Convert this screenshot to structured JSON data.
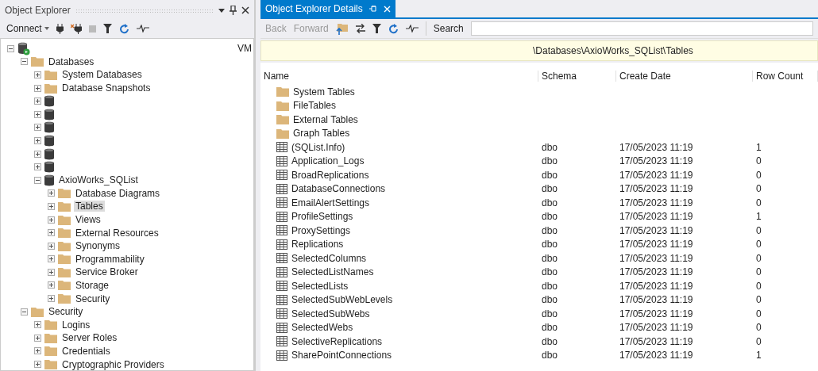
{
  "object_explorer": {
    "title": "Object Explorer",
    "toolbar": {
      "connect": "Connect"
    },
    "tree": [
      {
        "kind": "server",
        "label": "VM",
        "expanded": true,
        "selected": false,
        "children": [
          {
            "kind": "folder",
            "label": "Databases",
            "expanded": true,
            "selected": false,
            "children": [
              {
                "kind": "folder",
                "label": "System Databases",
                "expanded": false,
                "selected": false
              },
              {
                "kind": "folder",
                "label": "Database Snapshots",
                "expanded": false,
                "selected": false
              },
              {
                "kind": "database",
                "expanded": false,
                "selected": false
              },
              {
                "kind": "database",
                "expanded": false,
                "selected": false
              },
              {
                "kind": "database",
                "expanded": false,
                "selected": false
              },
              {
                "kind": "database",
                "expanded": false,
                "selected": false
              },
              {
                "kind": "database",
                "expanded": false,
                "selected": false
              },
              {
                "kind": "database",
                "expanded": false,
                "selected": false
              },
              {
                "kind": "database",
                "label": "AxioWorks_SQList",
                "expanded": true,
                "selected": false,
                "children": [
                  {
                    "kind": "folder",
                    "label": "Database Diagrams",
                    "expanded": false,
                    "selected": false
                  },
                  {
                    "kind": "folder",
                    "label": "Tables",
                    "expanded": false,
                    "selected": true
                  },
                  {
                    "kind": "folder",
                    "label": "Views",
                    "expanded": false,
                    "selected": false
                  },
                  {
                    "kind": "folder",
                    "label": "External Resources",
                    "expanded": false,
                    "selected": false
                  },
                  {
                    "kind": "folder",
                    "label": "Synonyms",
                    "expanded": false,
                    "selected": false
                  },
                  {
                    "kind": "folder",
                    "label": "Programmability",
                    "expanded": false,
                    "selected": false
                  },
                  {
                    "kind": "folder",
                    "label": "Service Broker",
                    "expanded": false,
                    "selected": false
                  },
                  {
                    "kind": "folder",
                    "label": "Storage",
                    "expanded": false,
                    "selected": false
                  },
                  {
                    "kind": "folder",
                    "label": "Security",
                    "expanded": false,
                    "selected": false
                  }
                ]
              }
            ]
          },
          {
            "kind": "folder",
            "label": "Security",
            "expanded": true,
            "selected": false,
            "children": [
              {
                "kind": "folder",
                "label": "Logins",
                "expanded": false,
                "selected": false
              },
              {
                "kind": "folder",
                "label": "Server Roles",
                "expanded": false,
                "selected": false
              },
              {
                "kind": "folder",
                "label": "Credentials",
                "expanded": false,
                "selected": false
              },
              {
                "kind": "folder",
                "label": "Cryptographic Providers",
                "expanded": false,
                "selected": false
              }
            ]
          }
        ]
      }
    ]
  },
  "details": {
    "tab": {
      "label": "Object Explorer Details",
      "selected": true
    },
    "toolbar": {
      "back": {
        "label": "Back",
        "disabled": true
      },
      "forward": {
        "label": "Forward",
        "disabled": true
      },
      "search_label": "Search"
    },
    "path": "\\Databases\\AxioWorks_SQList\\Tables",
    "table": {
      "columns": [
        "Name",
        "Schema",
        "Create Date",
        "Row Count"
      ],
      "rows": [
        {
          "kind": "folder",
          "name": "System Tables"
        },
        {
          "kind": "folder",
          "name": "FileTables"
        },
        {
          "kind": "folder",
          "name": "External Tables"
        },
        {
          "kind": "folder",
          "name": "Graph Tables"
        },
        {
          "kind": "table",
          "name": "(SQList.Info)",
          "schema": "dbo",
          "create_date": "17/05/2023 11:19",
          "row_count": "1"
        },
        {
          "kind": "table",
          "name": "Application_Logs",
          "schema": "dbo",
          "create_date": "17/05/2023 11:19",
          "row_count": "0"
        },
        {
          "kind": "table",
          "name": "BroadReplications",
          "schema": "dbo",
          "create_date": "17/05/2023 11:19",
          "row_count": "0"
        },
        {
          "kind": "table",
          "name": "DatabaseConnections",
          "schema": "dbo",
          "create_date": "17/05/2023 11:19",
          "row_count": "0"
        },
        {
          "kind": "table",
          "name": "EmailAlertSettings",
          "schema": "dbo",
          "create_date": "17/05/2023 11:19",
          "row_count": "0"
        },
        {
          "kind": "table",
          "name": "ProfileSettings",
          "schema": "dbo",
          "create_date": "17/05/2023 11:19",
          "row_count": "1"
        },
        {
          "kind": "table",
          "name": "ProxySettings",
          "schema": "dbo",
          "create_date": "17/05/2023 11:19",
          "row_count": "0"
        },
        {
          "kind": "table",
          "name": "Replications",
          "schema": "dbo",
          "create_date": "17/05/2023 11:19",
          "row_count": "0"
        },
        {
          "kind": "table",
          "name": "SelectedColumns",
          "schema": "dbo",
          "create_date": "17/05/2023 11:19",
          "row_count": "0"
        },
        {
          "kind": "table",
          "name": "SelectedListNames",
          "schema": "dbo",
          "create_date": "17/05/2023 11:19",
          "row_count": "0"
        },
        {
          "kind": "table",
          "name": "SelectedLists",
          "schema": "dbo",
          "create_date": "17/05/2023 11:19",
          "row_count": "0"
        },
        {
          "kind": "table",
          "name": "SelectedSubWebLevels",
          "schema": "dbo",
          "create_date": "17/05/2023 11:19",
          "row_count": "0"
        },
        {
          "kind": "table",
          "name": "SelectedSubWebs",
          "schema": "dbo",
          "create_date": "17/05/2023 11:19",
          "row_count": "0"
        },
        {
          "kind": "table",
          "name": "SelectedWebs",
          "schema": "dbo",
          "create_date": "17/05/2023 11:19",
          "row_count": "0"
        },
        {
          "kind": "table",
          "name": "SelectiveReplications",
          "schema": "dbo",
          "create_date": "17/05/2023 11:19",
          "row_count": "0"
        },
        {
          "kind": "table",
          "name": "SharePointConnections",
          "schema": "dbo",
          "create_date": "17/05/2023 11:19",
          "row_count": "1"
        }
      ]
    }
  }
}
